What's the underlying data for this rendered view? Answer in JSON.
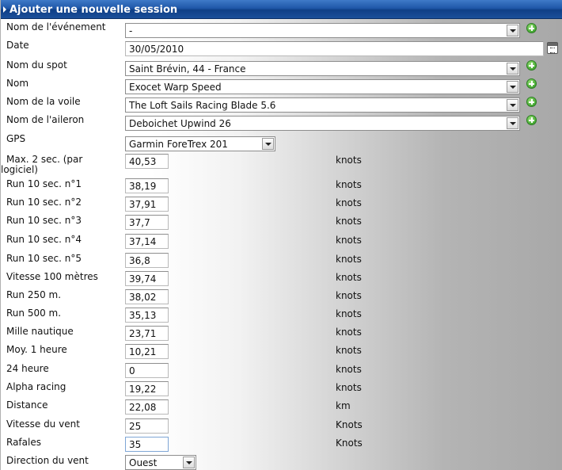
{
  "header": {
    "title": "Ajouter une nouvelle session"
  },
  "fields": {
    "event": {
      "label": "Nom de l'événement",
      "value": "-"
    },
    "date": {
      "label": "Date",
      "value": "30/05/2010"
    },
    "spot": {
      "label": "Nom du spot",
      "value": "Saint Brévin, 44 - France"
    },
    "board": {
      "label": "Nom",
      "value": "Exocet Warp Speed"
    },
    "sail": {
      "label": "Nom de la voile",
      "value": "The Loft Sails Racing Blade 5.6"
    },
    "fin": {
      "label": "Nom de l'aileron",
      "value": "Deboichet Upwind 26"
    },
    "gps": {
      "label": "GPS",
      "value": "Garmin ForeTrex 201"
    },
    "max2": {
      "label_line1": "Max. 2 sec. (par",
      "label_line2": "logiciel)",
      "value": "40,53",
      "unit": "knots"
    },
    "run1": {
      "label": "Run 10 sec. n°1",
      "value": "38,19",
      "unit": "knots"
    },
    "run2": {
      "label": "Run 10 sec. n°2",
      "value": "37,91",
      "unit": "knots"
    },
    "run3": {
      "label": "Run 10 sec. n°3",
      "value": "37,7",
      "unit": "knots"
    },
    "run4": {
      "label": "Run 10 sec. n°4",
      "value": "37,14",
      "unit": "knots"
    },
    "run5": {
      "label": "Run 10 sec. n°5",
      "value": "36,8",
      "unit": "knots"
    },
    "v100": {
      "label": "Vitesse 100 mètres",
      "value": "39,74",
      "unit": "knots"
    },
    "run250": {
      "label": "Run 250 m.",
      "value": "38,02",
      "unit": "knots"
    },
    "run500": {
      "label": "Run 500 m.",
      "value": "35,13",
      "unit": "knots"
    },
    "mile": {
      "label": "Mille nautique",
      "value": "23,71",
      "unit": "knots"
    },
    "moy1h": {
      "label": "Moy. 1 heure",
      "value": "10,21",
      "unit": "knots"
    },
    "h24": {
      "label": "24 heure",
      "value": "0",
      "unit": "knots"
    },
    "alpha": {
      "label": "Alpha racing",
      "value": "19,22",
      "unit": "knots"
    },
    "distance": {
      "label": "Distance",
      "value": "22,08",
      "unit": "km"
    },
    "wind": {
      "label": "Vitesse du vent",
      "value": "25",
      "unit": "Knots"
    },
    "gusts": {
      "label": "Rafales",
      "value": "35",
      "unit": "Knots"
    },
    "winddir": {
      "label": "Direction du vent",
      "value": "Ouest"
    }
  },
  "icons": {
    "add": "add-circle-icon",
    "calendar": "calendar-icon",
    "dropdown": "chevron-down-icon"
  },
  "colors": {
    "titlebar": "#1f57a8",
    "add_icon": "#4fb23a"
  }
}
